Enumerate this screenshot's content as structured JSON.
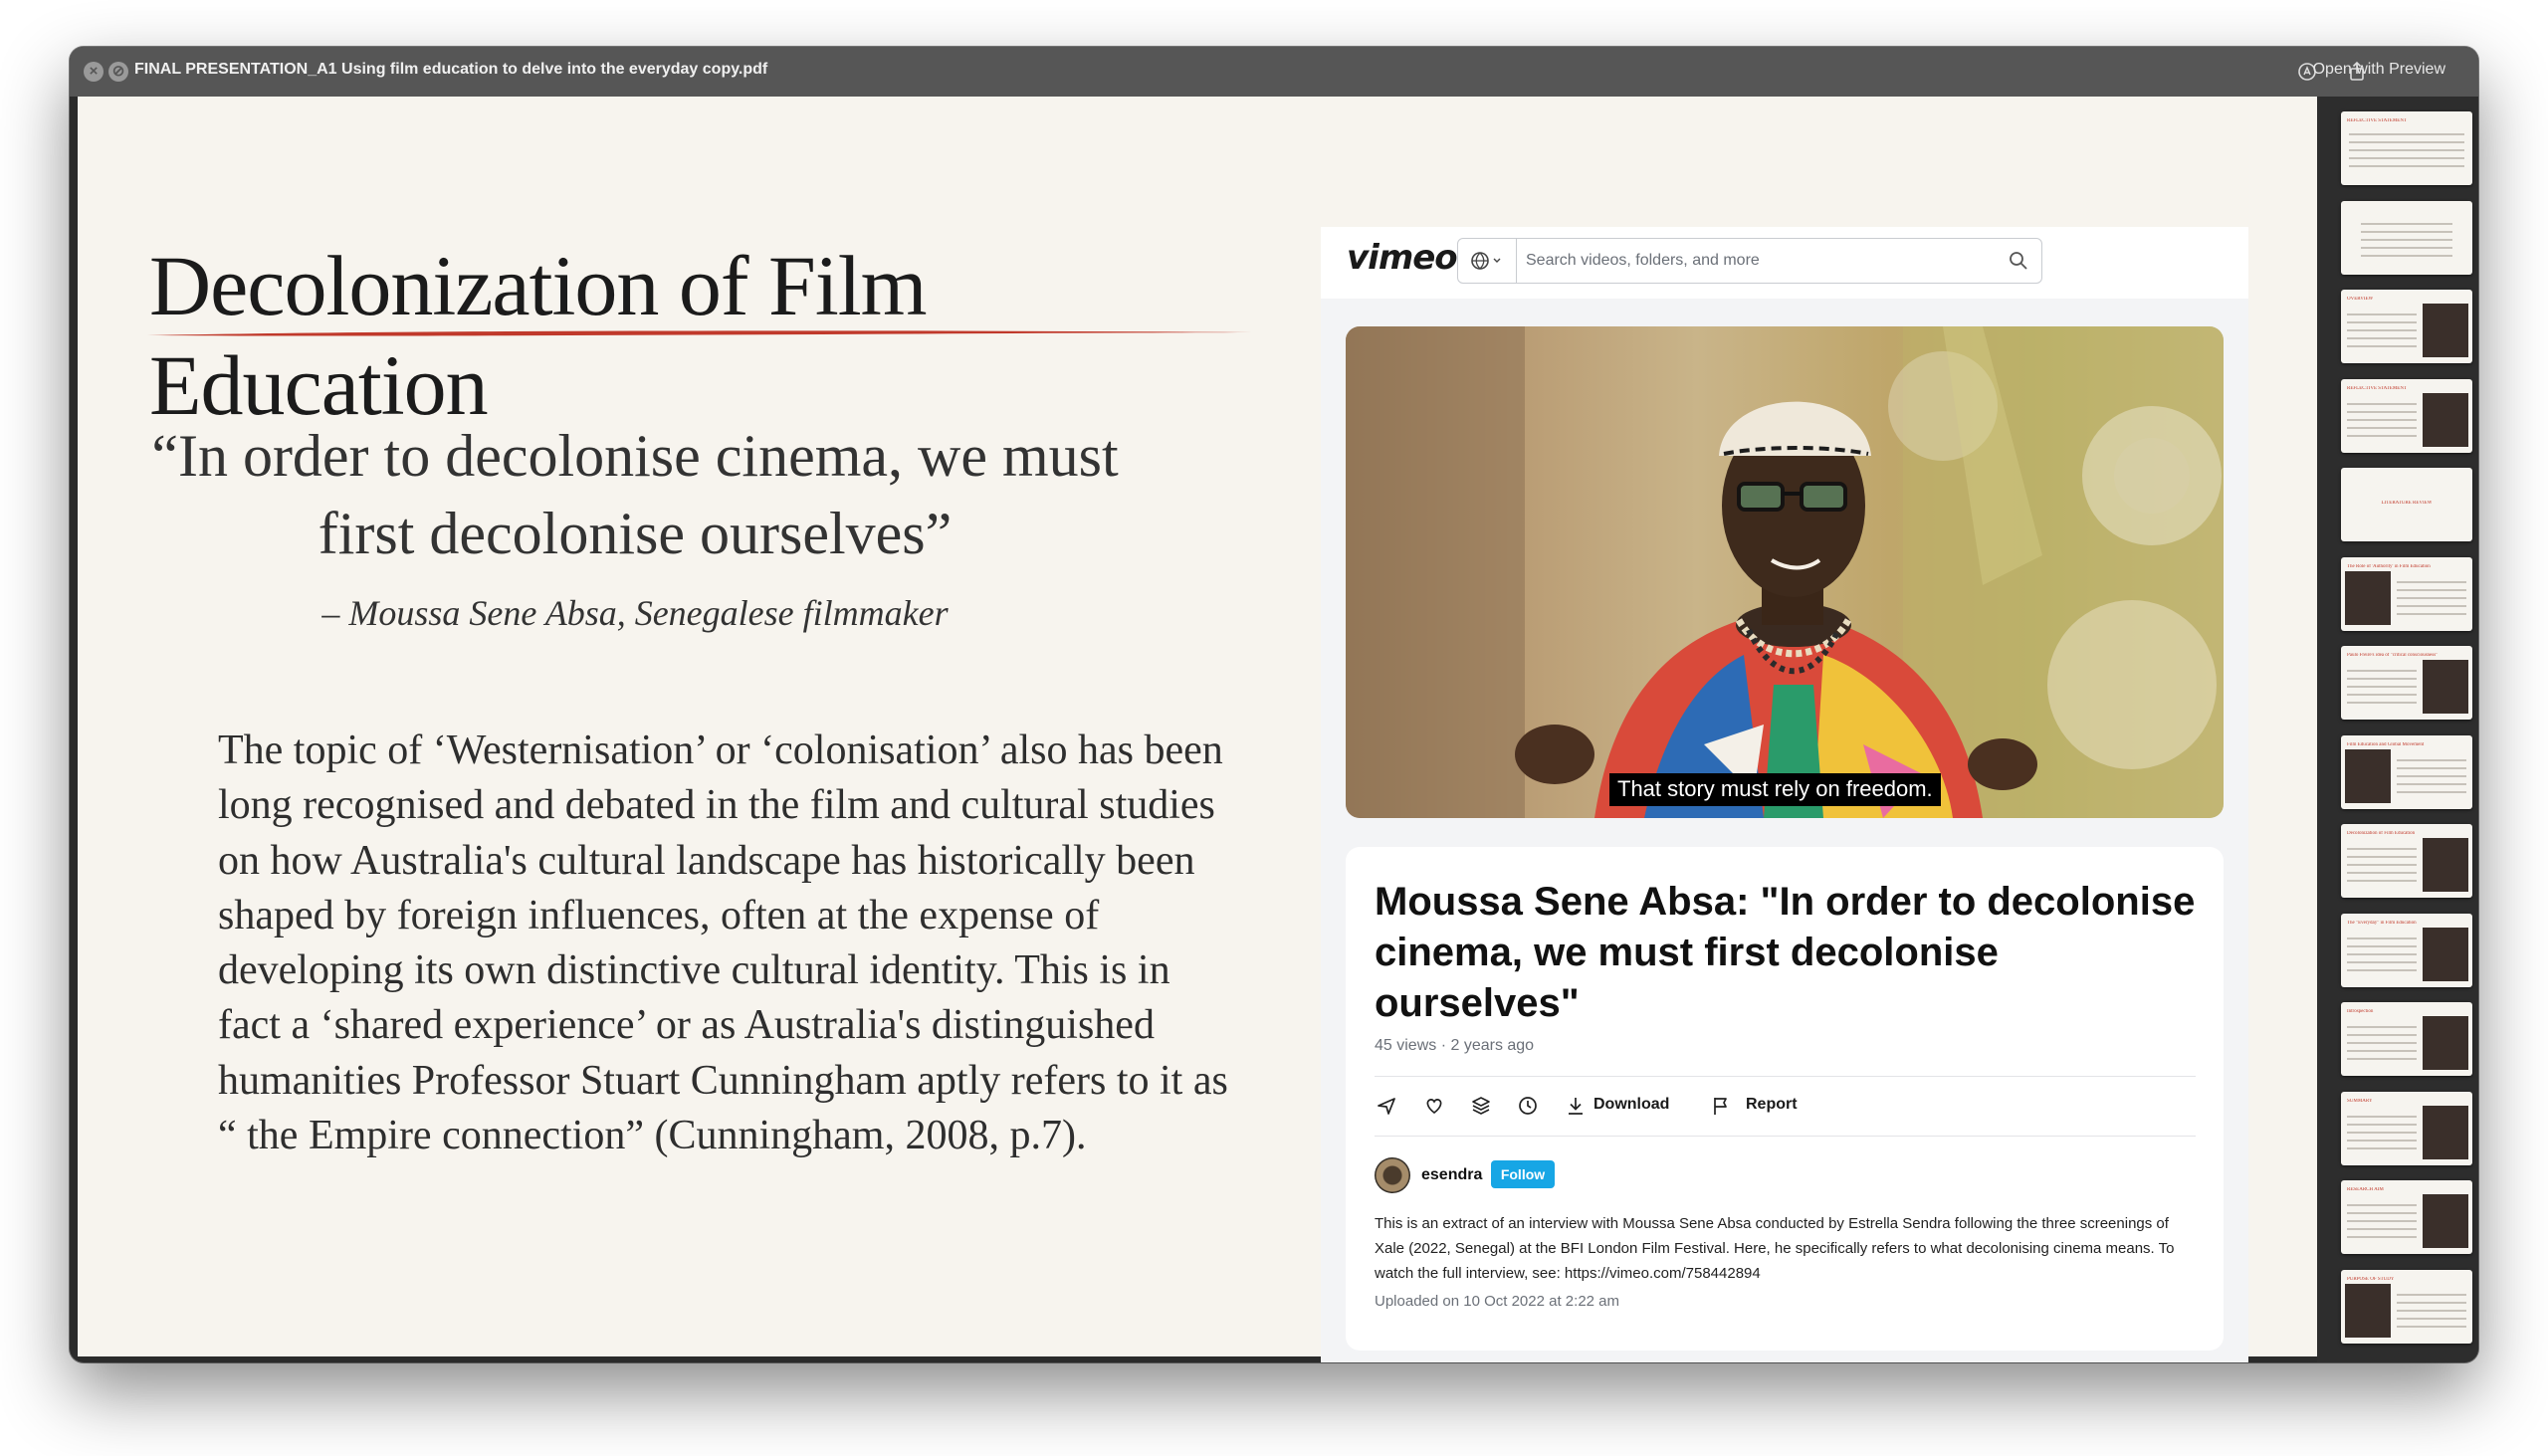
{
  "window": {
    "title": "FINAL PRESENTATION_A1 Using film education to delve into the everyday copy.pdf",
    "open_with": "Open with Preview"
  },
  "slide": {
    "heading": "Decolonization of Film Education",
    "quote": "“In order to decolonise cinema, we must first decolonise ourselves”",
    "attribution": "– Moussa Sene Absa, Senegalese filmmaker",
    "body": "The topic of ‘Westernisation’ or ‘colonisation’ also has been long recognised and debated in the film and cultural studies on how Australia's cultural landscape has historically been shaped by foreign influences, often at the expense of developing its own distinctive cultural identity. This is in fact a ‘shared experience’ or as Australia's distinguished humanities Professor Stuart Cunningham aptly refers to it as “ the Empire connection” (Cunningham, 2008, p.7).",
    "accent_color": "#c0392b"
  },
  "vimeo": {
    "logo": "vimeo",
    "search_placeholder": "Search videos, folders, and more",
    "subtitle": "That story must rely on freedom.",
    "video_title": "Moussa Sene Absa: \"In order to decolonise cinema, we must first decolonise ourselves\"",
    "meta": "45 views · 2 years ago",
    "actions": {
      "download": "Download",
      "report": "Report"
    },
    "author": "esendra",
    "follow": "Follow",
    "description": "This is an extract of an interview with Moussa Sene Absa conducted by Estrella Sendra following the three screenings of Xale (2022, Senegal) at the BFI London Film Festival. Here, he specifically refers to what decolonising cinema means. To watch the full interview, see: https://vimeo.com/758442894",
    "uploaded": "Uploaded on 10 Oct 2022 at 2:22 am",
    "follow_color": "#17a6e5"
  },
  "thumbnails": [
    {
      "label": "REFLECTIVE STATEMENT",
      "kind": "text"
    },
    {
      "label": "",
      "kind": "quote"
    },
    {
      "label": "OVERVIEW",
      "kind": "image-right"
    },
    {
      "label": "REFLECTIVE STATEMENT",
      "kind": "image-right"
    },
    {
      "label": "LITERATURE REVIEW",
      "kind": "center"
    },
    {
      "label": "The Role of 'Authority' in Film Education",
      "kind": "image-left"
    },
    {
      "label": "Paulo Freire's idea of \"critical consciousness\"",
      "kind": "image-right"
    },
    {
      "label": "Film Education and Global Movement",
      "kind": "image-left"
    },
    {
      "label": "Decolonization of Film Education",
      "kind": "image-right"
    },
    {
      "label": "The \"Everyday\" in Film Education",
      "kind": "image-right"
    },
    {
      "label": "Introspection",
      "kind": "image-right"
    },
    {
      "label": "SUMMARY",
      "kind": "image-right"
    },
    {
      "label": "RESEARCH AIM",
      "kind": "image-right"
    },
    {
      "label": "PURPOSE OF STUDY",
      "kind": "image-left"
    }
  ]
}
